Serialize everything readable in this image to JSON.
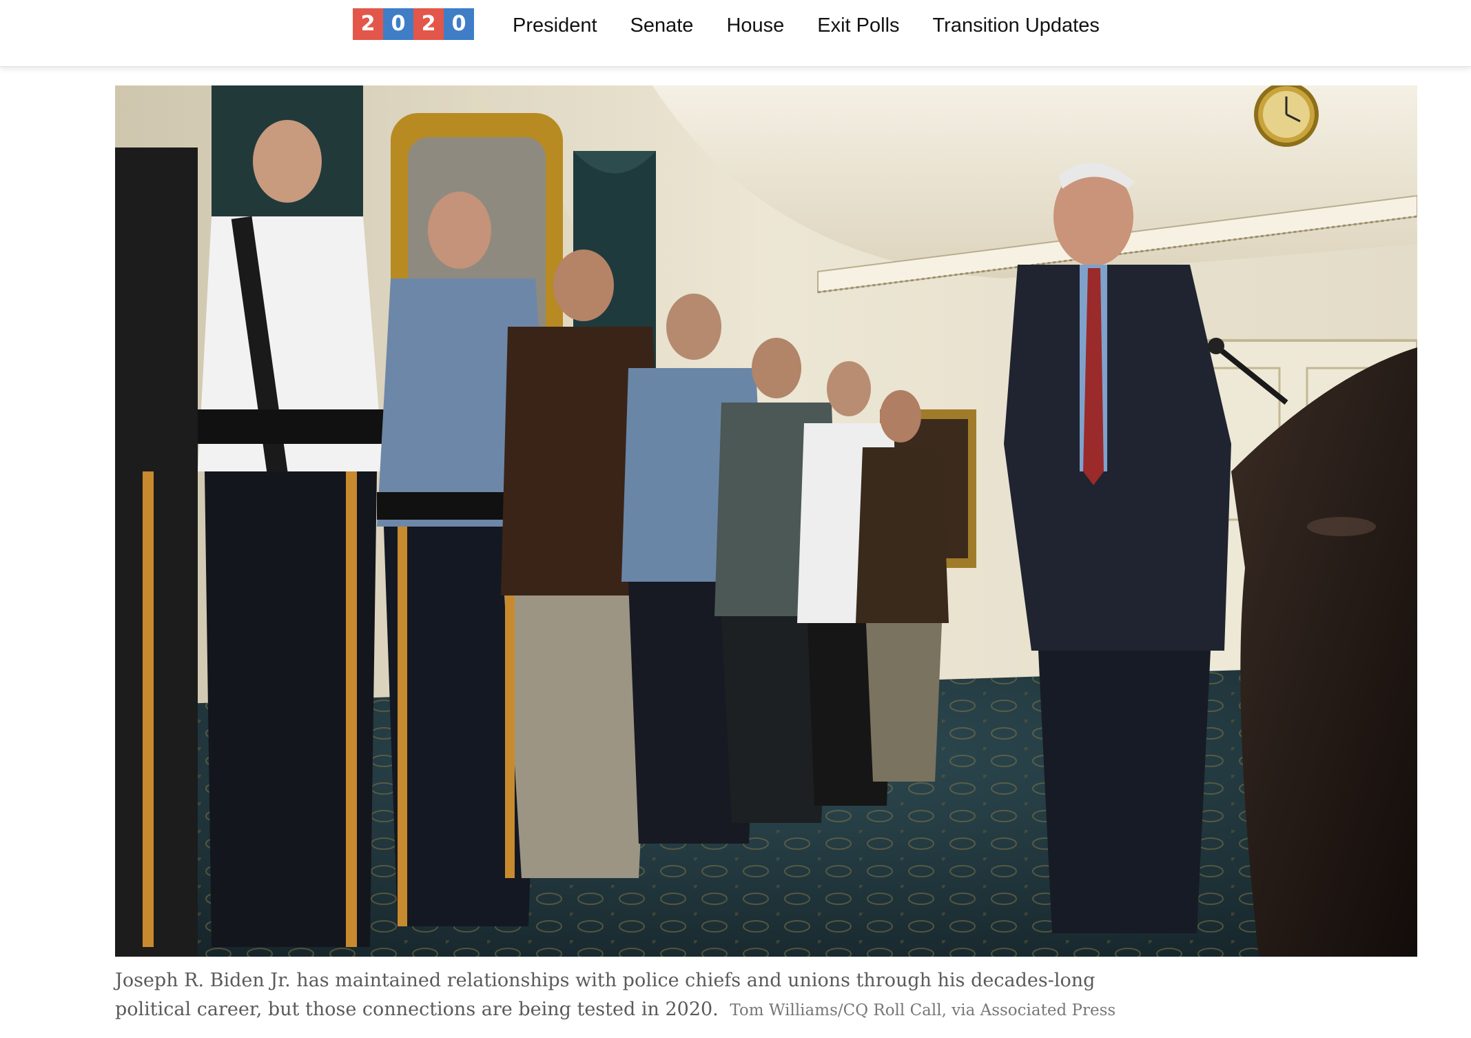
{
  "header": {
    "logo_digits": [
      "2",
      "0",
      "2",
      "0"
    ],
    "logo_colors": [
      "#e3574a",
      "#3f7ec7",
      "#e3574a",
      "#3f7ec7"
    ],
    "nav_items": [
      "President",
      "Senate",
      "House",
      "Exit Polls",
      "Transition Updates"
    ]
  },
  "photo": {
    "description_icon": "press-conference-photo"
  },
  "caption": {
    "text": "Joseph R. Biden Jr. has maintained relationships with police chiefs and unions through his decades-long political career, but those connections are being tested in 2020.",
    "credit": "Tom Williams/CQ Roll Call, via Associated Press"
  }
}
